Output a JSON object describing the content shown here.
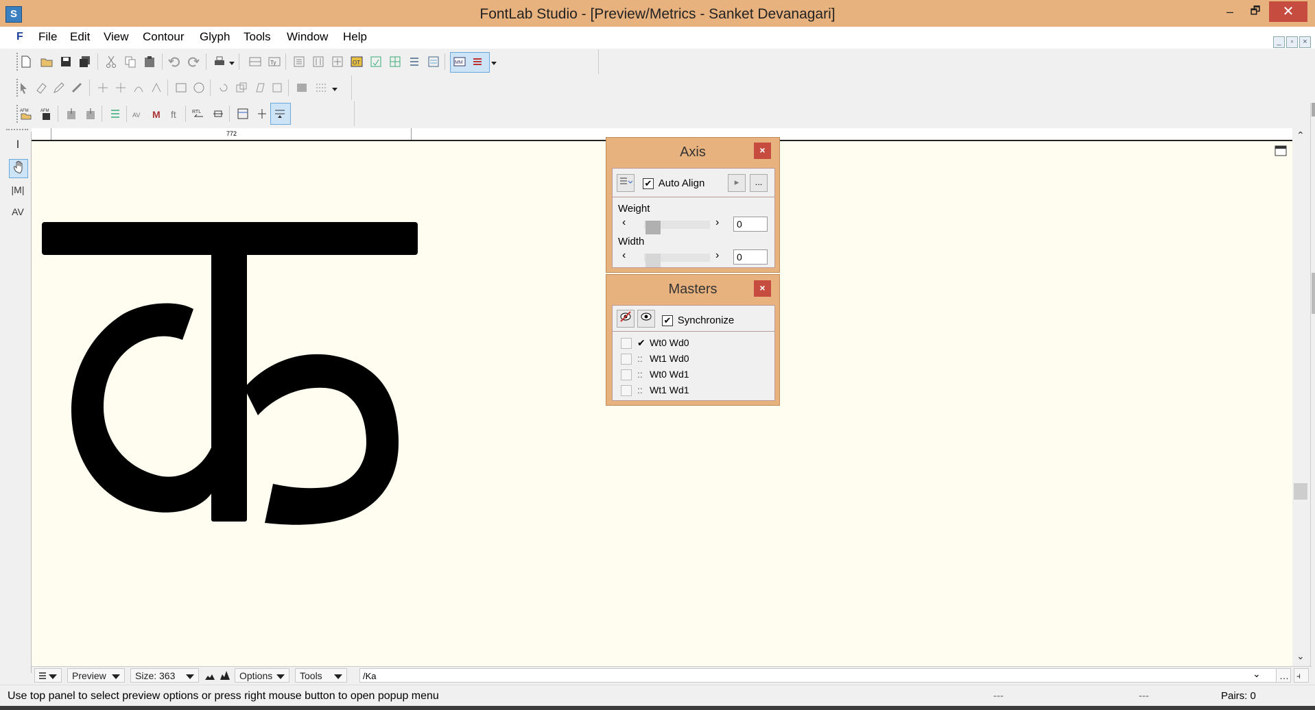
{
  "window": {
    "title": "FontLab Studio - [Preview/Metrics - Sanket Devanagari]",
    "app_icon": "S",
    "minimize": "–",
    "restore": "🗗",
    "close": "✕"
  },
  "menu": {
    "items": [
      "File",
      "Edit",
      "View",
      "Contour",
      "Glyph",
      "Tools",
      "Window",
      "Help"
    ],
    "logo": "F"
  },
  "ruler": {
    "label": "772"
  },
  "canvas": {
    "glyph_name": "Ka"
  },
  "left_tools": [
    "I",
    "hand",
    "|M|",
    "AV"
  ],
  "axis_panel": {
    "title": "Axis",
    "close": "×",
    "auto_align_label": "Auto Align",
    "auto_align_checked": true,
    "more": "...",
    "weight_label": "Weight",
    "weight_value": "0",
    "width_label": "Width",
    "width_value": "0"
  },
  "masters_panel": {
    "title": "Masters",
    "close": "×",
    "synchronize_label": "Synchronize",
    "synchronize_checked": true,
    "masters": [
      {
        "label": "Wt0 Wd0",
        "mark": "✔"
      },
      {
        "label": "Wt1 Wd0",
        "mark": "::"
      },
      {
        "label": "Wt0 Wd1",
        "mark": "::"
      },
      {
        "label": "Wt1 Wd1",
        "mark": "::"
      }
    ]
  },
  "bottom_bar": {
    "preview": "Preview",
    "size": "Size: 363",
    "options": "Options",
    "tools": "Tools",
    "text": "/Ka"
  },
  "status": {
    "message": "Use top panel to select preview options or press right mouse button to open popup menu",
    "cell1": "---",
    "cell2": "---",
    "pairs": "Pairs: 0"
  },
  "colors": {
    "title_bar": "#e8b27e",
    "close_red": "#c74c40",
    "canvas_bg": "#fffdf0",
    "glyph": "#000000"
  }
}
